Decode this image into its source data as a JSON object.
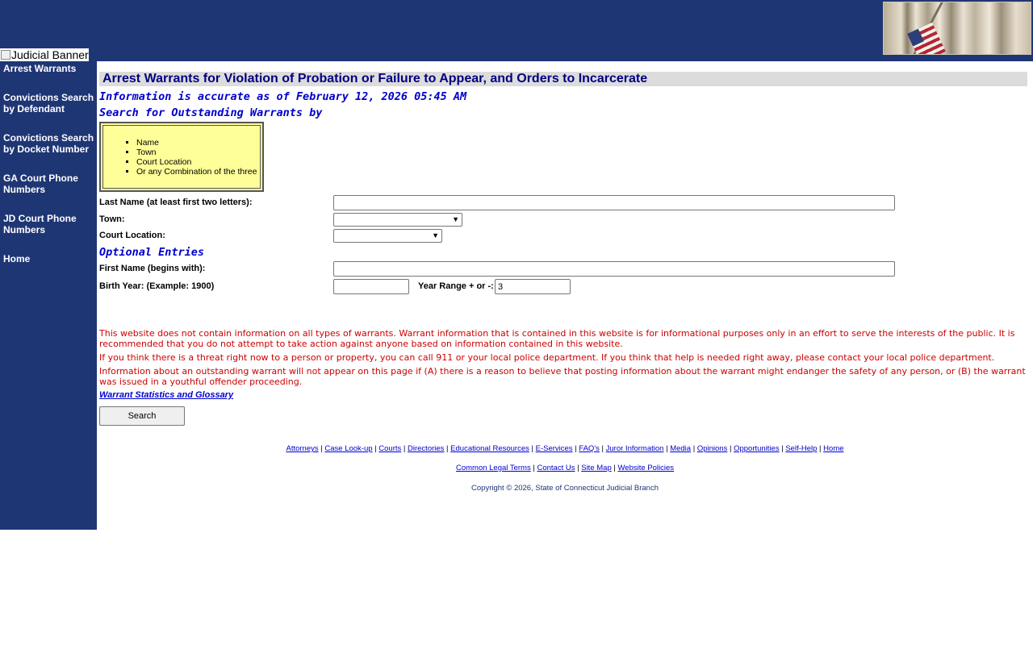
{
  "banner": {
    "alt_text": "Judicial Banner"
  },
  "sidebar": {
    "items": [
      {
        "label": "Arrest Warrants"
      },
      {
        "label": "Convictions Search by Defendant"
      },
      {
        "label": "Convictions Search by Docket Number"
      },
      {
        "label": "GA Court Phone Numbers"
      },
      {
        "label": "JD Court Phone Numbers"
      },
      {
        "label": "Home"
      }
    ]
  },
  "main": {
    "title": "Arrest Warrants for Violation of Probation or Failure to Appear, and Orders to Incarcerate",
    "accuracy": "Information is accurate as of February 12, 2026 05:45 AM",
    "search_heading": "Search for Outstanding Warrants by",
    "criteria": [
      "Name",
      "Town",
      "Court Location",
      "Or any Combination of the three"
    ],
    "form": {
      "last_name_label": "Last Name (at least first two letters):",
      "last_name_value": "",
      "town_label": "Town:",
      "town_value": "",
      "court_label": "Court Location:",
      "court_value": "",
      "optional_heading": "Optional Entries",
      "first_name_label": "First Name (begins with):",
      "first_name_value": "",
      "birth_year_label": "Birth Year: (Example: 1900)",
      "birth_year_value": "",
      "year_range_label": "Year Range + or -:",
      "year_range_value": "3"
    },
    "notices": [
      "This website does not contain information on all types of warrants. Warrant information that is contained in this website is for informational purposes only in an effort to serve the interests of the public. It is recommended that you do not attempt to take action against anyone based on information contained in this website.",
      "If you think there is a threat right now to a person or property, you can call 911 or your local police department. If you think that help is needed right away, please contact your local police department.",
      "Information about an outstanding warrant will not appear on this page if (A) there is a reason to believe that posting information about the warrant might endanger the safety of any person, or (B) the warrant was issued in a youthful offender proceeding."
    ],
    "stats_link": "Warrant Statistics and Glossary",
    "search_button": "Search"
  },
  "footer": {
    "row1": [
      "Attorneys",
      "Case Look-up",
      "Courts",
      "Directories",
      "Educational Resources",
      "E-Services",
      "FAQ's",
      "Juror Information",
      "Media",
      "Opinions",
      "Opportunities",
      "Self-Help",
      "Home"
    ],
    "row2": [
      "Common Legal Terms",
      "Contact Us",
      "Site Map",
      "Website Policies"
    ],
    "separator": " | ",
    "copyright": "Copyright © 2026, State of Connecticut Judicial Branch"
  },
  "colors": {
    "banner_bg": "#1f3675",
    "title_text": "#000080",
    "heading_text": "#0000cc",
    "notice_text": "#cc0000",
    "criteria_bg": "#ffff99"
  }
}
